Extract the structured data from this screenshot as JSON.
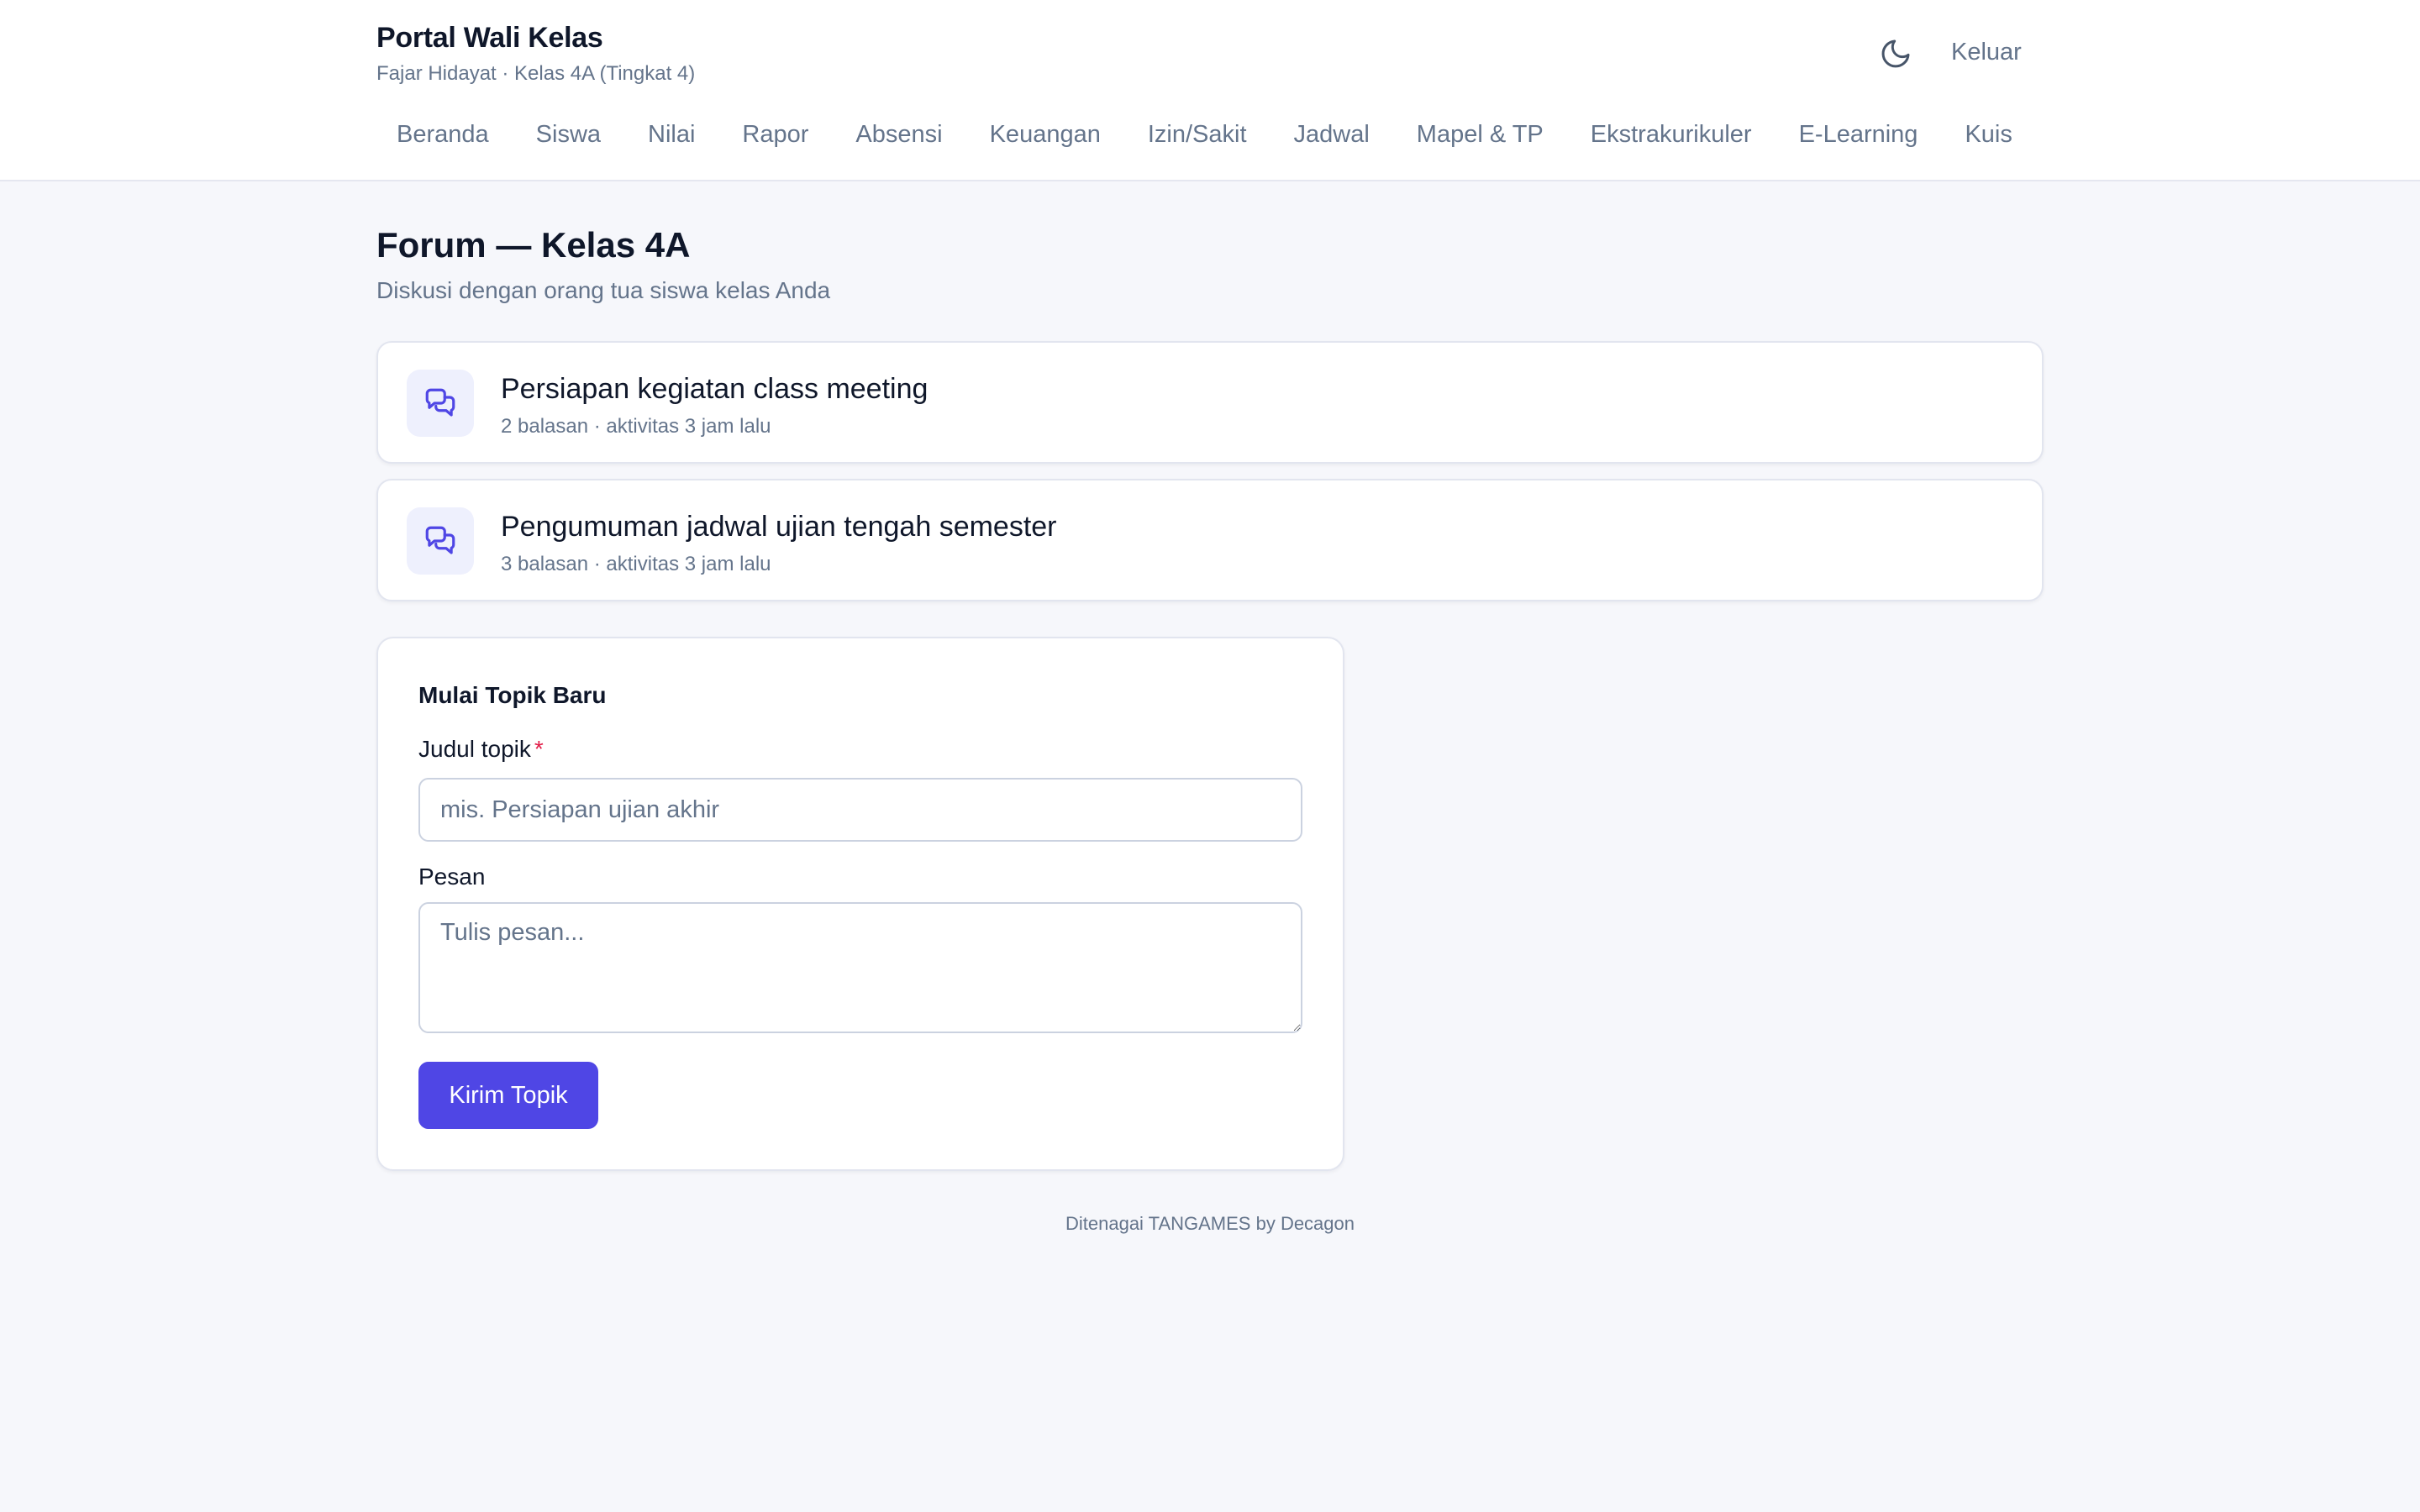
{
  "header": {
    "title": "Portal Wali Kelas",
    "subtitle": "Fajar Hidayat · Kelas 4A (Tingkat 4)",
    "theme_icon": "moon-icon",
    "logout_label": "Keluar"
  },
  "nav": {
    "items": [
      {
        "label": "Beranda"
      },
      {
        "label": "Siswa"
      },
      {
        "label": "Nilai"
      },
      {
        "label": "Rapor"
      },
      {
        "label": "Absensi"
      },
      {
        "label": "Keuangan"
      },
      {
        "label": "Izin/Sakit"
      },
      {
        "label": "Jadwal"
      },
      {
        "label": "Mapel & TP"
      },
      {
        "label": "Ekstrakurikuler"
      },
      {
        "label": "E-Learning"
      },
      {
        "label": "Kuis"
      }
    ]
  },
  "page": {
    "title": "Forum — Kelas 4A",
    "subtitle": "Diskusi dengan orang tua siswa kelas Anda"
  },
  "topics": [
    {
      "title": "Persiapan kegiatan class meeting",
      "meta": "2 balasan · aktivitas 3 jam lalu",
      "icon": "chat-bubbles-icon"
    },
    {
      "title": "Pengumuman jadwal ujian tengah semester",
      "meta": "3 balasan · aktivitas 3 jam lalu",
      "icon": "chat-bubbles-icon"
    }
  ],
  "form": {
    "heading": "Mulai Topik Baru",
    "title_label": "Judul topik",
    "required_mark": "*",
    "title_value": "",
    "title_placeholder": "mis. Persiapan ujian akhir",
    "message_label": "Pesan",
    "message_value": "",
    "message_placeholder": "Tulis pesan...",
    "submit_label": "Kirim Topik"
  },
  "footer": {
    "text": "Ditenagai TANGAMES by Decagon"
  },
  "colors": {
    "accent": "#4f46e5",
    "background": "#f6f7fb",
    "muted_text": "#64748b",
    "required": "#e11d48",
    "icon_tile": "#eef0fd"
  }
}
